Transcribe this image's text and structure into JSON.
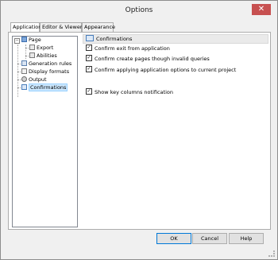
{
  "window": {
    "title": "Options",
    "close_glyph": "✕"
  },
  "tabs": [
    {
      "label": "Application"
    },
    {
      "label": "Editor & Viewers"
    },
    {
      "label": "Appearance"
    }
  ],
  "tree": {
    "items": [
      {
        "label": "Page"
      },
      {
        "label": "Export"
      },
      {
        "label": "Abilities"
      },
      {
        "label": "Generation rules"
      },
      {
        "label": "Display formats"
      },
      {
        "label": "Output"
      },
      {
        "label": "Confirmations"
      }
    ],
    "expander_glyph": "−"
  },
  "panel": {
    "header": "Confirmations",
    "options": [
      {
        "label": "Confirm exit from application",
        "checked": "✓"
      },
      {
        "label": "Confirm create pages though invalid queries",
        "checked": "✓"
      },
      {
        "label": "Confirm applying application options to current project",
        "checked": "✓"
      },
      {
        "label": "Show key columns notification",
        "checked": "✓"
      }
    ]
  },
  "buttons": {
    "ok": "OK",
    "cancel": "Cancel",
    "help": "Help"
  },
  "colors": {
    "selection": "#cce8ff",
    "close": "#c75050",
    "default_border": "#0078d7"
  }
}
